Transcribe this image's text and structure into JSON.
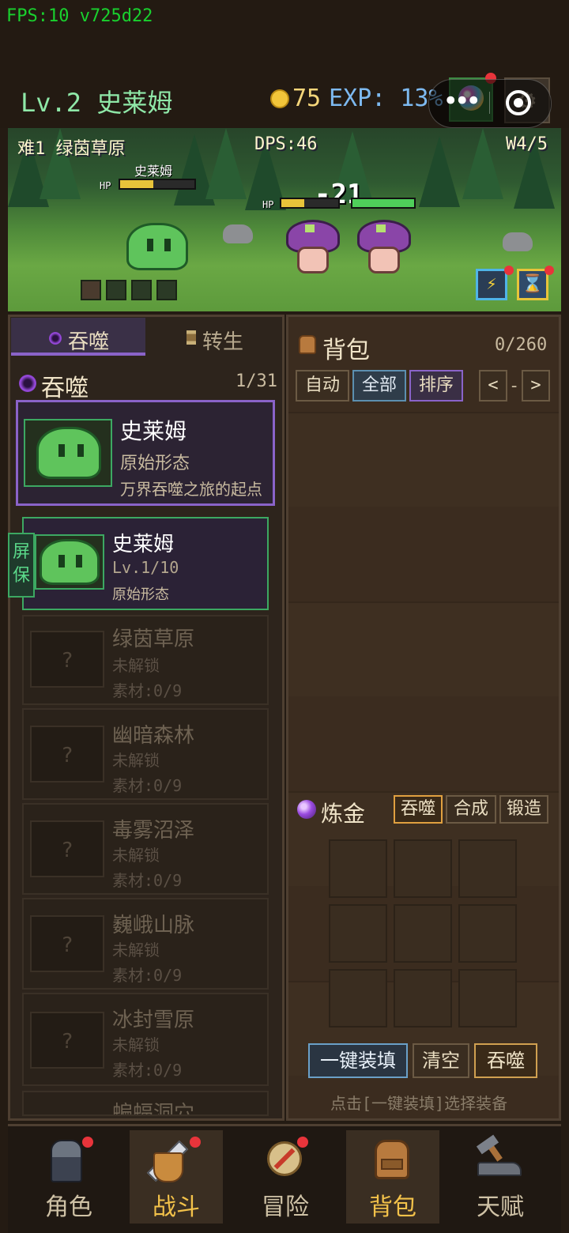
{
  "status": {
    "fps": "FPS:10 v725d22"
  },
  "header": {
    "level": "Lv.2 史莱姆",
    "gold": "75",
    "exp": "EXP: 13%",
    "gear_icon": "gear-icon",
    "capsule_more": "•••"
  },
  "battle": {
    "zone": "难1 绿茵草原",
    "dps": "DPS:46",
    "wave": "W4/5",
    "player_name": "史莱姆",
    "hp_label": "HP",
    "damage": "-21",
    "player_hp_pct": 45,
    "enemy1_hp_pct": 40,
    "enemy2_hp_pct": 100,
    "speed_icon": "⚡",
    "time_icon": "⌛"
  },
  "left": {
    "tabs": [
      {
        "label": "吞噬"
      },
      {
        "label": "转生"
      }
    ],
    "section_title": "吞噬",
    "count": "1/31",
    "featured": {
      "name": "史莱姆",
      "form": "原始形态",
      "desc": "万界吞噬之旅的起点"
    },
    "current": {
      "name": "史莱姆",
      "level": "Lv.1/10",
      "form": "原始形态"
    },
    "screensaver": [
      "屏",
      "保"
    ],
    "locked": [
      {
        "name": "绿茵草原",
        "status": "未解锁",
        "material": "素材:0/9"
      },
      {
        "name": "幽暗森林",
        "status": "未解锁",
        "material": "素材:0/9"
      },
      {
        "name": "毒雾沼泽",
        "status": "未解锁",
        "material": "素材:0/9"
      },
      {
        "name": "巍峨山脉",
        "status": "未解锁",
        "material": "素材:0/9"
      },
      {
        "name": "冰封雪原",
        "status": "未解锁",
        "material": "素材:0/9"
      },
      {
        "name": "蝙蝠洞穴"
      }
    ],
    "locked_mark": "?"
  },
  "bag": {
    "title": "背包",
    "capacity": "0/260",
    "filters": [
      "自动",
      "全部",
      "排序"
    ],
    "prev": "<",
    "page": "-",
    "next": ">"
  },
  "alchemy": {
    "title": "炼金",
    "tabs": [
      "吞噬",
      "合成",
      "锻造"
    ],
    "actions": [
      "一键装填",
      "清空",
      "吞噬"
    ],
    "hint": "点击[一键装填]选择装备"
  },
  "nav": [
    {
      "label": "角色",
      "icon": "knight-icon"
    },
    {
      "label": "战斗",
      "icon": "sword-shield-icon"
    },
    {
      "label": "冒险",
      "icon": "compass-icon"
    },
    {
      "label": "背包",
      "icon": "backpack-icon"
    },
    {
      "label": "天赋",
      "icon": "anvil-icon"
    }
  ],
  "colors": {
    "accent_purple": "#8a63c9",
    "accent_green": "#3ca862",
    "alert_red": "#e8343b"
  }
}
